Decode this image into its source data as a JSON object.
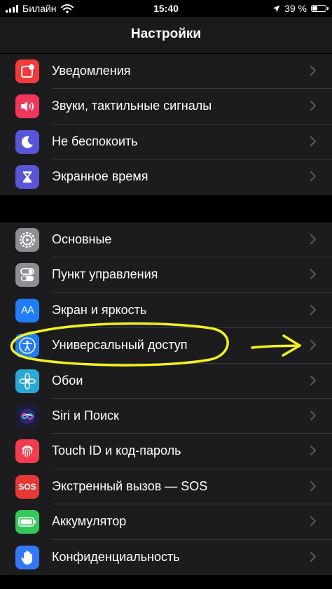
{
  "status_bar": {
    "carrier": "Билайн",
    "time": "15:40",
    "battery": "39 %",
    "battery_level": 0.39
  },
  "nav": {
    "title": "Настройки"
  },
  "group1": [
    {
      "label": "Уведомления",
      "icon": "notifications-icon",
      "color": "#f23c3c"
    },
    {
      "label": "Звуки, тактильные сигналы",
      "icon": "speaker-icon",
      "color": "#f0365b"
    },
    {
      "label": "Не беспокоить",
      "icon": "moon-icon",
      "color": "#5856d6"
    },
    {
      "label": "Экранное время",
      "icon": "hourglass-icon",
      "color": "#5856d6"
    }
  ],
  "group2": [
    {
      "label": "Основные",
      "icon": "gear-icon",
      "color": "#8e8e93"
    },
    {
      "label": "Пункт управления",
      "icon": "toggles-icon",
      "color": "#8e8e93"
    },
    {
      "label": "Экран и яркость",
      "icon": "text-size-icon",
      "color": "#1f7ef7",
      "icon_text": "AA"
    },
    {
      "label": "Универсальный доступ",
      "icon": "accessibility-icon",
      "color": "#1f7ef7"
    },
    {
      "label": "Обои",
      "icon": "flower-icon",
      "color": "#2aa9d6"
    },
    {
      "label": "Siri и Поиск",
      "icon": "siri-icon",
      "color": "#1b1b3a"
    },
    {
      "label": "Touch ID и код-пароль",
      "icon": "fingerprint-icon",
      "color": "#f23c4f"
    },
    {
      "label": "Экстренный вызов — SOS",
      "icon": "sos-icon",
      "color": "#e53935",
      "icon_text": "SOS"
    },
    {
      "label": "Аккумулятор",
      "icon": "battery-icon",
      "color": "#34c759"
    },
    {
      "label": "Конфиденциальность",
      "icon": "hand-icon",
      "color": "#3478f6"
    }
  ],
  "annotation": {
    "color": "#f5f020",
    "highlighted_item": "Универсальный доступ"
  }
}
